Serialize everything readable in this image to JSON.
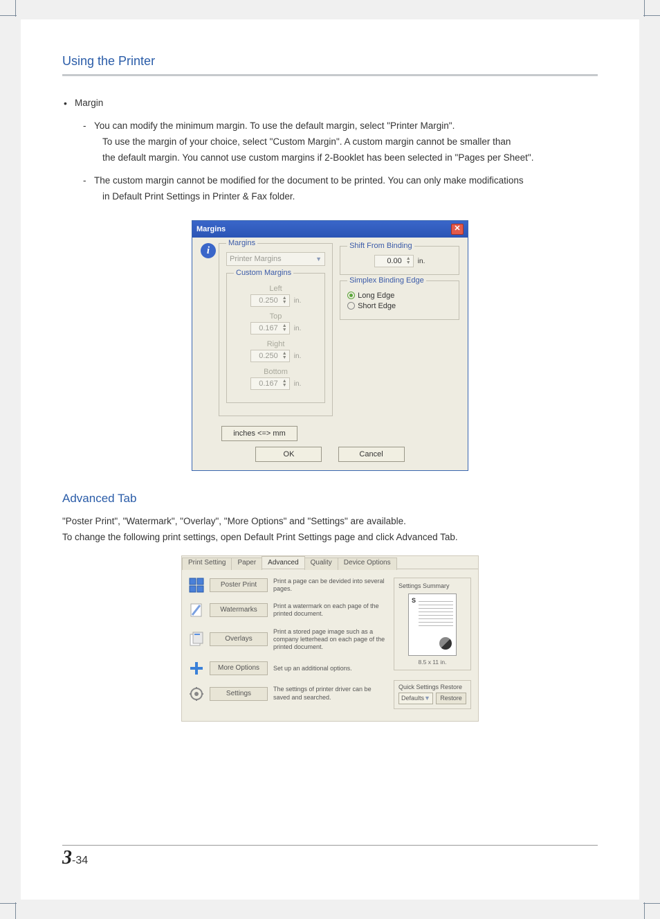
{
  "header": {
    "section_title": "Using the Printer"
  },
  "body": {
    "bullet_title": "Margin",
    "dash1_line1": "You can modify the minimum margin. To use the default margin, select \"Printer Margin\".",
    "dash1_line2": "To use the margin of your choice, select \"Custom Margin\". A custom margin cannot be smaller than",
    "dash1_line3": "the default margin. You cannot use custom margins if 2-Booklet has been selected in \"Pages per Sheet\".",
    "dash2_line1": "The custom margin cannot be modified for the document to be printed. You can only make modifications",
    "dash2_line2": " in Default Print Settings in Printer & Fax folder."
  },
  "margins_dialog": {
    "title": "Margins",
    "info_badge": "i",
    "margins_legend": "Margins",
    "dropdown_value": "Printer Margins",
    "custom_legend": "Custom Margins",
    "left_label": "Left",
    "left_value": "0.250",
    "left_unit": "in.",
    "top_label": "Top",
    "top_value": "0.167",
    "top_unit": "in.",
    "right_label": "Right",
    "right_value": "0.250",
    "right_unit": "in.",
    "bottom_label": "Bottom",
    "bottom_value": "0.167",
    "bottom_unit": "in.",
    "shift_legend": "Shift From Binding",
    "shift_value": "0.00",
    "shift_unit": "in.",
    "simplex_legend": "Simplex Binding Edge",
    "radio_long": "Long Edge",
    "radio_short": "Short Edge",
    "units_btn": "inches <=> mm",
    "ok_btn": "OK",
    "cancel_btn": "Cancel"
  },
  "advanced": {
    "heading": "Advanced Tab",
    "p1": "\"Poster Print\", \"Watermark\", \"Overlay\", \"More Options\" and \"Settings\" are available.",
    "p2": "To change the following print settings, open Default Print Settings page and click Advanced Tab."
  },
  "adv_panel": {
    "tabs": {
      "print_setting": "Print Setting",
      "paper": "Paper",
      "advanced": "Advanced",
      "quality": "Quality",
      "device_options": "Device Options"
    },
    "rows": [
      {
        "btn": "Poster Print",
        "desc": "Print a page can be devided into several pages."
      },
      {
        "btn": "Watermarks",
        "desc": "Print a watermark on each page of the printed document."
      },
      {
        "btn": "Overlays",
        "desc": "Print a stored page image such as a company letterhead on each page of the printed document."
      },
      {
        "btn": "More Options",
        "desc": "Set up an additional options."
      },
      {
        "btn": "Settings",
        "desc": "The settings of printer driver can be saved and searched."
      }
    ],
    "summary": {
      "title": "Settings Summary",
      "s_label": "S",
      "paper_size": "8.5 x 11 in."
    },
    "restore": {
      "title": "Quick Settings Restore",
      "select_value": "Defaults",
      "btn": "Restore"
    }
  },
  "footer": {
    "chapter": "3",
    "page": "-34"
  }
}
